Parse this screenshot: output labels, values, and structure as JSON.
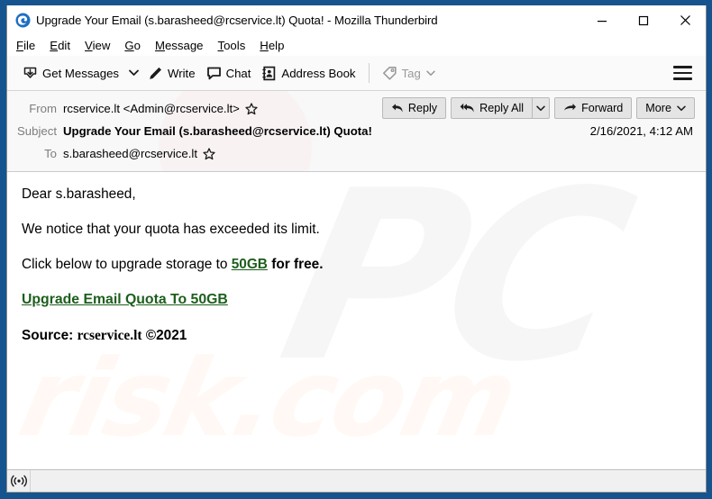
{
  "window": {
    "title": "Upgrade Your Email (s.barasheed@rcservice.lt) Quota! - Mozilla Thunderbird",
    "app_icon": "thunderbird-icon",
    "border_color": "#15548f",
    "controls": {
      "minimize": "minimize-icon",
      "maximize": "maximize-icon",
      "close": "close-icon"
    }
  },
  "menubar": {
    "items": [
      {
        "label": "File",
        "accesskey": "F"
      },
      {
        "label": "Edit",
        "accesskey": "E"
      },
      {
        "label": "View",
        "accesskey": "V"
      },
      {
        "label": "Go",
        "accesskey": "G"
      },
      {
        "label": "Message",
        "accesskey": "M"
      },
      {
        "label": "Tools",
        "accesskey": "T"
      },
      {
        "label": "Help",
        "accesskey": "H"
      }
    ]
  },
  "toolbar": {
    "get_messages": "Get Messages",
    "get_messages_icon": "inbox-download-icon",
    "get_messages_caret": "chevron-down-icon",
    "write": "Write",
    "write_icon": "pencil-icon",
    "chat": "Chat",
    "chat_icon": "chat-bubble-icon",
    "address_book": "Address Book",
    "address_book_icon": "address-book-icon",
    "tag": "Tag",
    "tag_icon": "tag-icon",
    "tag_caret": "chevron-down-icon",
    "tag_disabled": true,
    "menu_icon": "hamburger-menu-icon"
  },
  "message_header": {
    "from_label": "From",
    "from_value": "rcservice.lt <Admin@rcservice.lt>",
    "from_star": "star-outline-icon",
    "subject_label": "Subject",
    "subject_value": "Upgrade Your Email (s.barasheed@rcservice.lt) Quota!",
    "to_label": "To",
    "to_value": "s.barasheed@rcservice.lt",
    "to_star": "star-outline-icon",
    "date": "2/16/2021, 4:12 AM",
    "actions": {
      "reply": "Reply",
      "reply_icon": "reply-arrow-icon",
      "reply_all": "Reply All",
      "reply_all_icon": "reply-all-arrow-icon",
      "reply_all_caret": "chevron-down-icon",
      "forward": "Forward",
      "forward_icon": "forward-arrow-icon",
      "more": "More",
      "more_caret": "chevron-down-icon"
    }
  },
  "message_body": {
    "greeting": "Dear s.barasheed,",
    "line_notice": "We notice that your quota has exceeded its limit.",
    "line_cta_prefix": "Click below to upgrade storage to ",
    "line_cta_highlight": "50GB",
    "line_cta_suffix": " for free.",
    "link_text": "Upgrade Email Quota To 50GB",
    "source_label": "Source: ",
    "source_domain": "rcservice.lt",
    "source_copyright": " ©2021",
    "link_color": "#1d5e1d"
  },
  "watermarks": {
    "top": "PC",
    "bottom": "risk.com"
  },
  "statusbar": {
    "icon": "wireless-broadcast-icon",
    "text": ""
  }
}
